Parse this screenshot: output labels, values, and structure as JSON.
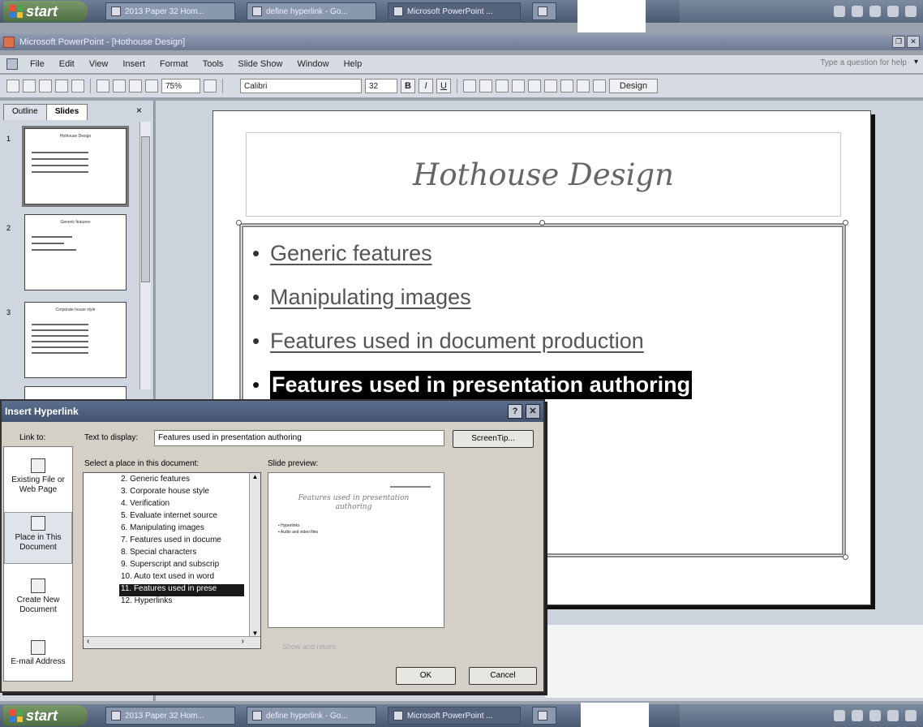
{
  "taskbar": {
    "start_label": "start",
    "tasks": [
      "2013 Paper 32 Hom...",
      "define hyperlink - Go...",
      "Microsoft PowerPoint ..."
    ],
    "active_task": 2
  },
  "window": {
    "title": "Microsoft PowerPoint - [Hothouse Design]"
  },
  "menu": {
    "items": [
      "File",
      "Edit",
      "View",
      "Insert",
      "Format",
      "Tools",
      "Slide Show",
      "Window",
      "Help"
    ],
    "ask_placeholder": "Type a question for help"
  },
  "toolbar": {
    "zoom": "75%",
    "font": "Calibri",
    "font_size": "32",
    "bold": "B",
    "italic": "I",
    "underline": "U",
    "design_label": "Design"
  },
  "left_pane": {
    "tabs": [
      "Outline",
      "Slides"
    ],
    "close": "×",
    "thumbs": [
      {
        "num": "1",
        "title": "Hothouse Design"
      },
      {
        "num": "2",
        "title": "Generic features"
      },
      {
        "num": "3",
        "title": "Corporate house style"
      }
    ]
  },
  "slide": {
    "title": "Hothouse Design",
    "bullets": [
      "Generic features",
      "Manipulating images",
      "Features used in document production",
      "Features used in presentation authoring"
    ],
    "highlighted_bullet": 3
  },
  "dialog": {
    "title": "Insert Hyperlink",
    "help": "?",
    "close": "✕",
    "link_to_label": "Link to:",
    "link_to_items": [
      "Existing File or Web Page",
      "Place in This Document",
      "Create New Document",
      "E-mail Address"
    ],
    "text_to_display_label": "Text to display:",
    "text_to_display_value": "Features used in presentation authoring",
    "screentip_label": "ScreenTip...",
    "select_place_label": "Select a place in this document:",
    "places": [
      "2. Generic features",
      "3. Corporate house style",
      "4. Verification",
      "5. Evaluate internet source",
      "6. Manipulating images",
      "7. Features used in docume",
      "8. Special characters",
      "9. Superscript and subscrip",
      "10. Auto text used in word",
      "11. Features used in prese",
      "12. Hyperlinks"
    ],
    "selected_place": 9,
    "slide_preview_label": "Slide preview:",
    "preview_title": "Features used in presentation authoring",
    "preview_bullets": [
      "Hyperlinks",
      "Audio and video files"
    ],
    "show_and_return": "Show and return",
    "ok_label": "OK",
    "cancel_label": "Cancel"
  }
}
